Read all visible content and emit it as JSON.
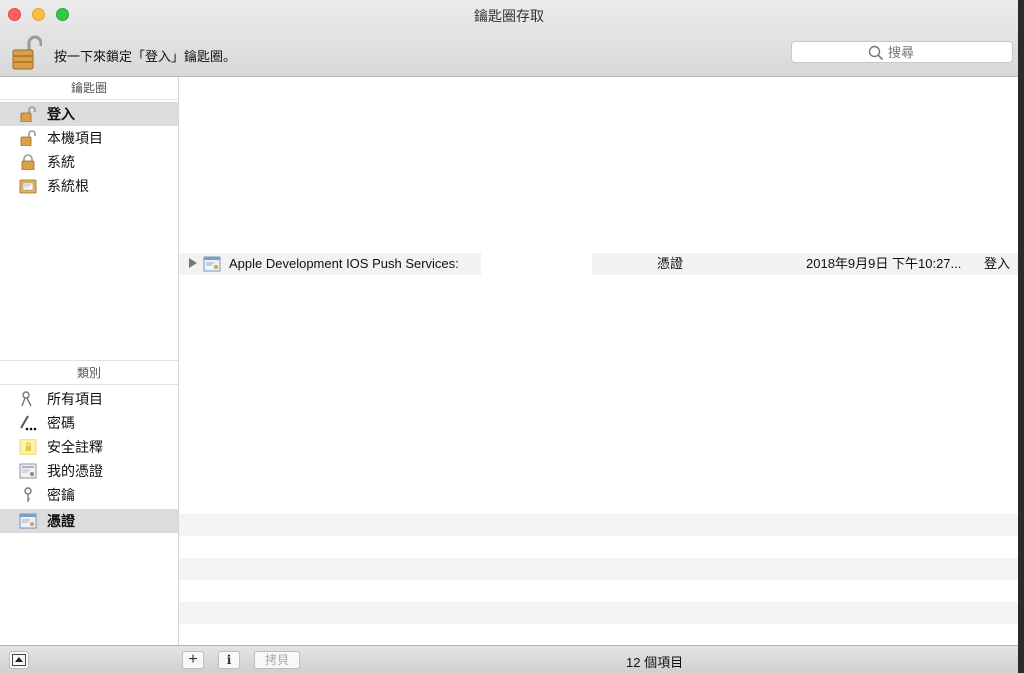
{
  "window": {
    "title": "鑰匙圈存取"
  },
  "toolbar": {
    "lock_text": "按一下來鎖定「登入」鑰匙圈。",
    "search_placeholder": "搜尋"
  },
  "sidebar": {
    "keychains_header": "鑰匙圈",
    "keychains": [
      {
        "label": "登入",
        "icon": "unlocked-padlock-icon",
        "selected": true
      },
      {
        "label": "本機項目",
        "icon": "unlocked-padlock-icon",
        "selected": false
      },
      {
        "label": "系統",
        "icon": "locked-padlock-icon",
        "selected": false
      },
      {
        "label": "系統根",
        "icon": "certificate-folder-icon",
        "selected": false
      }
    ],
    "category_header": "類別",
    "categories": [
      {
        "label": "所有項目",
        "icon": "keys-icon",
        "selected": false
      },
      {
        "label": "密碼",
        "icon": "password-pencil-icon",
        "selected": false
      },
      {
        "label": "安全註釋",
        "icon": "secure-note-icon",
        "selected": false
      },
      {
        "label": "我的憑證",
        "icon": "my-certificate-icon",
        "selected": false
      },
      {
        "label": "密鑰",
        "icon": "key-icon",
        "selected": false
      },
      {
        "label": "憑證",
        "icon": "certificate-icon",
        "selected": true
      }
    ]
  },
  "list": {
    "rows": [
      {
        "name": "Apple Development IOS Push Services:",
        "kind": "憑證",
        "date": "2018年9月9日 下午10:27...",
        "keychain": "登入"
      }
    ]
  },
  "bottombar": {
    "add_label": "+",
    "info_label": "i",
    "copy_label": "拷貝",
    "count_text": "12 個項目"
  },
  "colors": {
    "selected_row": "#dcdcdc",
    "lock_gold": "#d9a04a",
    "close": "#fc605c",
    "minimize": "#fdbc40",
    "maximize": "#34c84a"
  }
}
